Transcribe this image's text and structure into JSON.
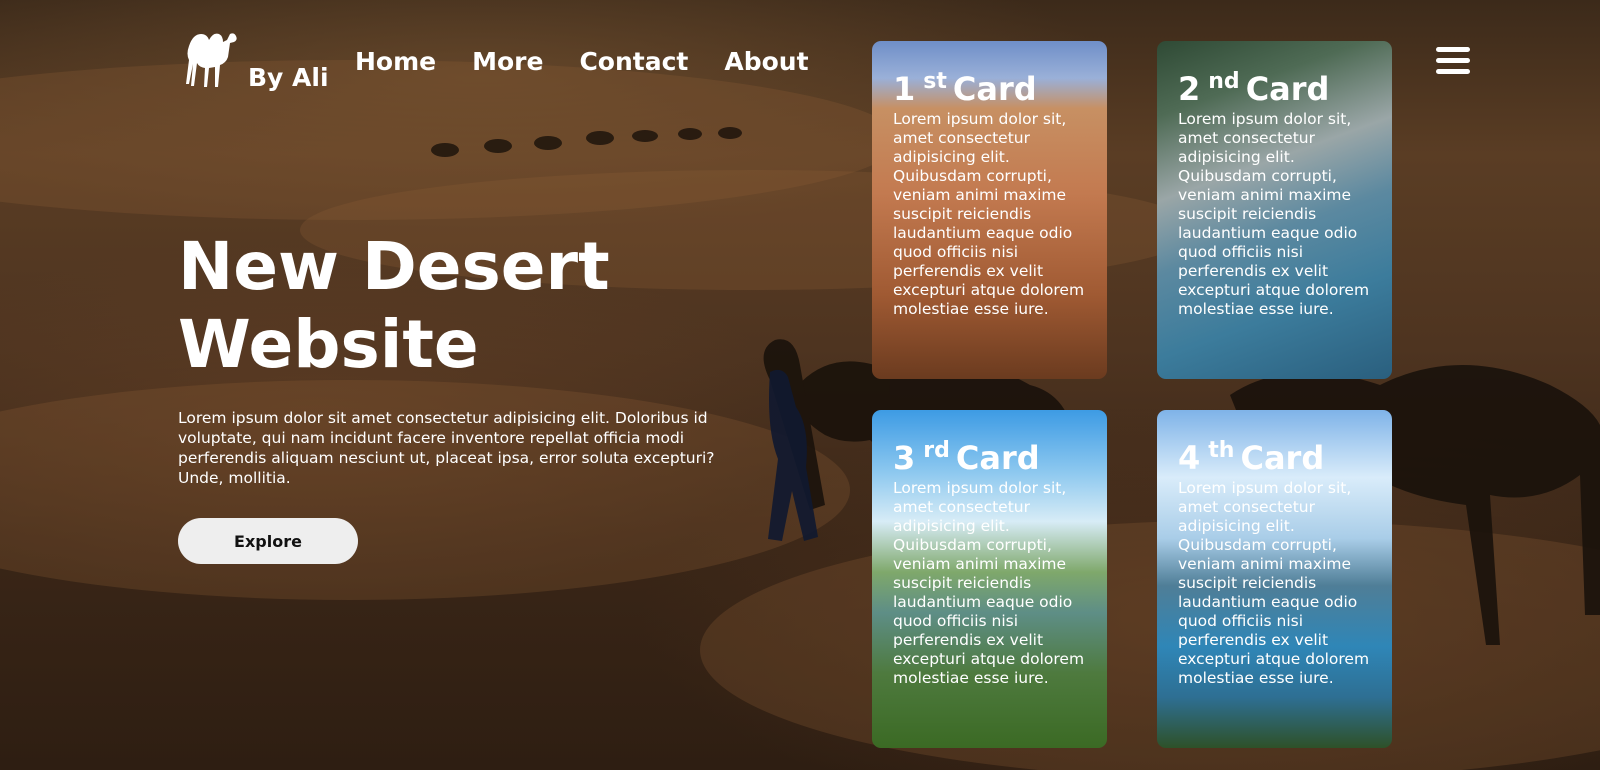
{
  "brand": {
    "name": "By Ali",
    "logo_icon": "camel-icon"
  },
  "nav": {
    "items": [
      "Home",
      "More",
      "Contact",
      "About"
    ]
  },
  "menu_icon": "hamburger-icon",
  "hero": {
    "title": "New Desert Website",
    "text": "Lorem ipsum dolor sit amet consectetur adipisicing elit. Doloribus id voluptate, qui nam incidunt facere inventore repellat officia modi perferendis aliquam nesciunt ut, placeat ipsa, error soluta excepturi? Unde, mollitia.",
    "button_label": "Explore"
  },
  "cards": [
    {
      "number": "1",
      "suffix": "st",
      "label": "Card",
      "text": "Lorem ipsum dolor sit, amet consectetur adipisicing elit. Quibusdam corrupti, veniam animi maxime suscipit reiciendis laudantium eaque odio quod officiis nisi perferendis ex velit excepturi atque dolorem molestiae esse iure."
    },
    {
      "number": "2",
      "suffix": "nd",
      "label": "Card",
      "text": "Lorem ipsum dolor sit, amet consectetur adipisicing elit. Quibusdam corrupti, veniam animi maxime suscipit reiciendis laudantium eaque odio quod officiis nisi perferendis ex velit excepturi atque dolorem molestiae esse iure."
    },
    {
      "number": "3",
      "suffix": "rd",
      "label": "Card",
      "text": "Lorem ipsum dolor sit, amet consectetur adipisicing elit. Quibusdam corrupti, veniam animi maxime suscipit reiciendis laudantium eaque odio quod officiis nisi perferendis ex velit excepturi atque dolorem molestiae esse iure."
    },
    {
      "number": "4",
      "suffix": "th",
      "label": "Card",
      "text": "Lorem ipsum dolor sit, amet consectetur adipisicing elit. Quibusdam corrupti, veniam animi maxime suscipit reiciendis laudantium eaque odio quod officiis nisi perferendis ex velit excepturi atque dolorem molestiae esse iure."
    }
  ]
}
